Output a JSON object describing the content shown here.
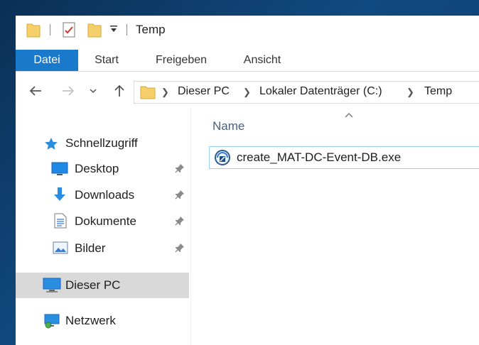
{
  "window": {
    "title": "Temp"
  },
  "ribbon": {
    "tabs": [
      "Datei",
      "Start",
      "Freigeben",
      "Ansicht"
    ],
    "active": "Datei"
  },
  "address": {
    "crumbs": [
      "Dieser PC",
      "Lokaler Datenträger (C:)",
      "Temp"
    ]
  },
  "nav": {
    "quick_access": "Schnellzugriff",
    "pinned": [
      "Desktop",
      "Downloads",
      "Dokumente",
      "Bilder"
    ],
    "this_pc": "Dieser PC",
    "network": "Netzwerk"
  },
  "content": {
    "column_header": "Name",
    "files": [
      {
        "name": "create_MAT-DC-Event-DB.exe"
      }
    ]
  },
  "colors": {
    "accent": "#1979ca",
    "selection_border": "#99d1ff",
    "selected_nav": "#d9d9d9",
    "folder": "#f5cf6a"
  },
  "icons": [
    "folder-icon",
    "properties-icon",
    "new-folder-icon",
    "customize-dropdown-icon",
    "back-arrow-icon",
    "forward-arrow-icon",
    "recent-chevron-icon",
    "up-arrow-icon",
    "star-icon",
    "desktop-icon",
    "download-arrow-icon",
    "document-icon",
    "pictures-icon",
    "computer-icon",
    "network-icon",
    "pin-icon",
    "installer-icon",
    "sort-chevron-icon"
  ]
}
